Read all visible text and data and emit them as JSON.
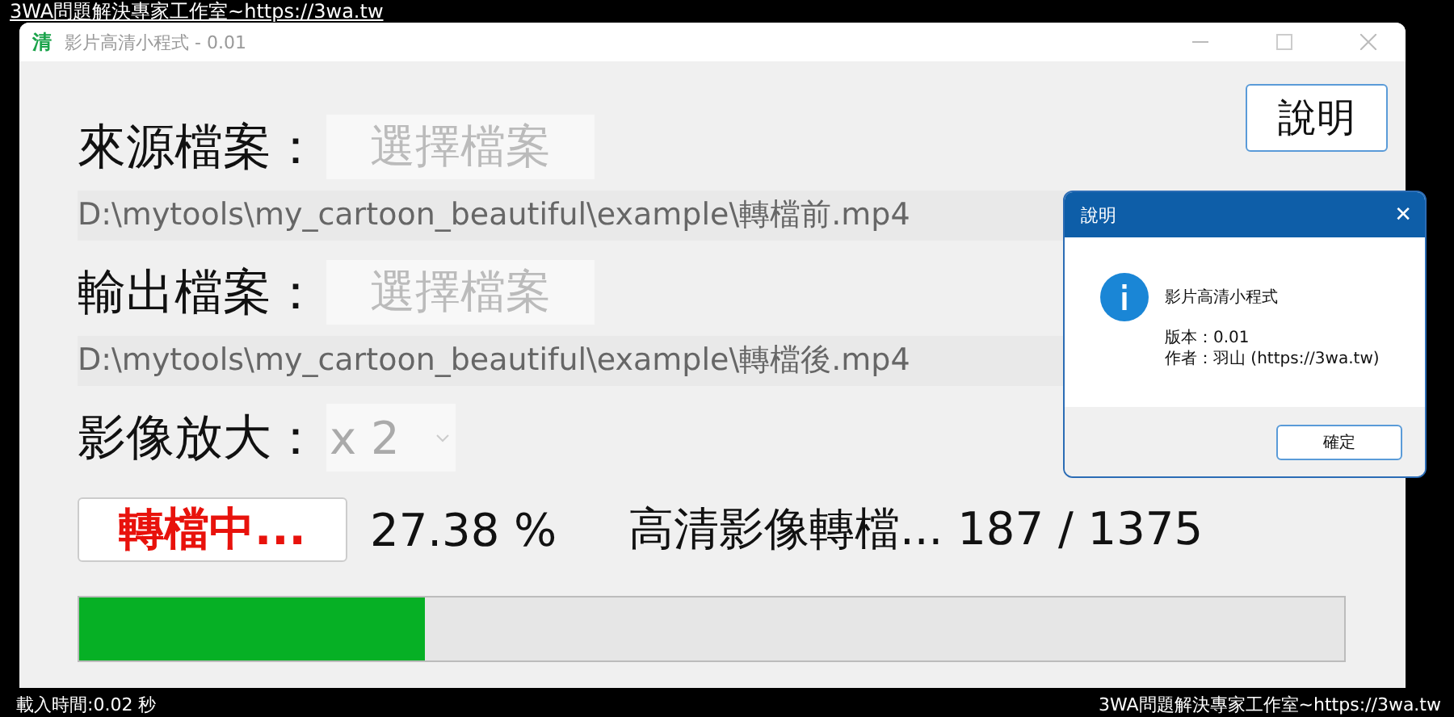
{
  "top_caption": "3WA問題解決專家工作室~https://3wa.tw",
  "window": {
    "icon": "清",
    "title": "影片高清小程式 - 0.01"
  },
  "help_button": "說明",
  "source": {
    "label": "來源檔案：",
    "button": "選擇檔案",
    "disabled": true,
    "path": "D:\\mytools\\my_cartoon_beautiful\\example\\轉檔前.mp4"
  },
  "output": {
    "label": "輸出檔案：",
    "button": "選擇檔案",
    "disabled": true,
    "path": "D:\\mytools\\my_cartoon_beautiful\\example\\轉檔後.mp4"
  },
  "scale": {
    "label": "影像放大：",
    "value": "x 2",
    "disabled": true
  },
  "convert_button": {
    "label": "轉檔中...",
    "busy": true
  },
  "percent": "27.38 %",
  "status": "高清影像轉檔... 187 / 1375",
  "progress": {
    "level": 0.2738
  },
  "dialog": {
    "title": "說明",
    "close": "✕",
    "heading": "影片高清小程式",
    "lines": [
      "版本：0.01",
      "作者：羽山 (https://3wa.tw)"
    ],
    "ok": "確定"
  },
  "load_time": "載入時間:0.02 秒",
  "bottom_caption": "3WA問題解決專家工作室~https://3wa.tw"
}
